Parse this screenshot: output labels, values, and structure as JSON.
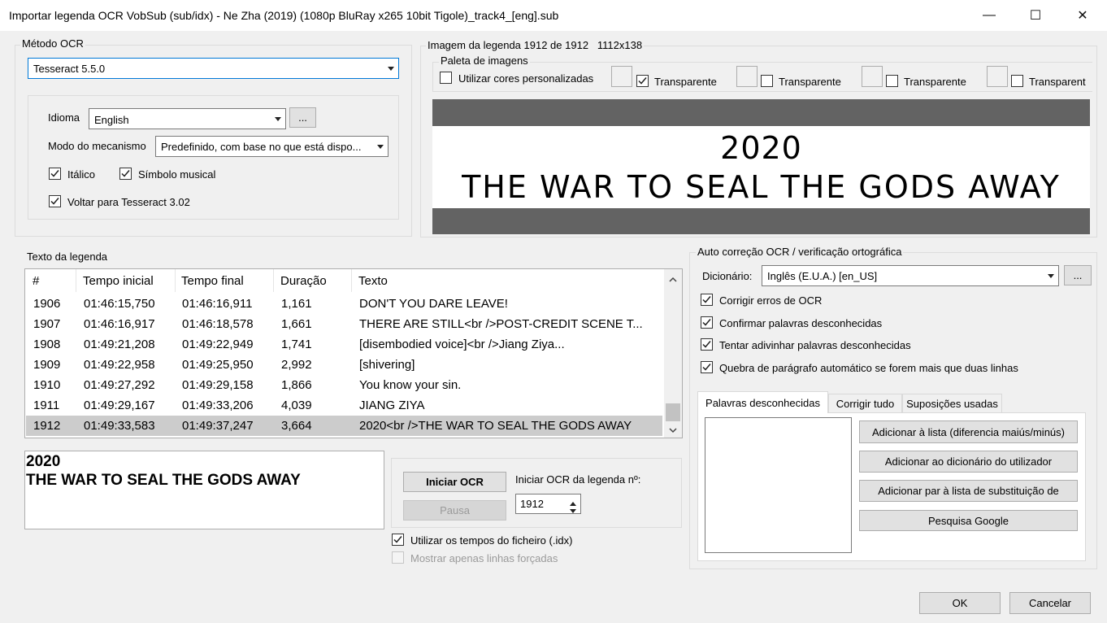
{
  "window": {
    "title": "Importar legenda OCR VobSub (sub/idx) - Ne Zha (2019) (1080p BluRay x265 10bit Tigole)_track4_[eng].sub",
    "minimize": "—",
    "maximize": "☐",
    "close": "✕"
  },
  "ocr_method": {
    "group_label": "Método OCR",
    "engine": "Tesseract 5.5.0",
    "language_label": "Idioma",
    "language": "English",
    "language_more": "...",
    "engine_mode_label": "Modo do mecanismo",
    "engine_mode": "Predefinido, com base no que está dispo...",
    "italic_label": "Itálico",
    "italic_checked": true,
    "music_label": "Símbolo musical",
    "music_checked": true,
    "fallback_label": "Voltar para Tesseract 3.02",
    "fallback_checked": true
  },
  "image": {
    "group_label": "Imagem da legenda 1912 de 1912   1112x138",
    "palette_label": "Paleta de imagens",
    "custom_colors_label": "Utilizar cores personalizadas",
    "custom_colors_checked": false,
    "transparent_label": "Transparente",
    "transparent_label_cut": "Transparent",
    "transparent_checked": [
      true,
      false,
      false,
      false
    ],
    "preview_line1": "2020",
    "preview_line2": "THE WAR TO SEAL THE GODS AWAY"
  },
  "subtitles": {
    "group_label": "Texto da legenda",
    "columns": [
      "#",
      "Tempo inicial",
      "Tempo final",
      "Duração",
      "Texto"
    ],
    "rows": [
      [
        "1906",
        "01:46:15,750",
        "01:46:16,911",
        "1,161",
        "DON'T YOU DARE LEAVE!"
      ],
      [
        "1907",
        "01:46:16,917",
        "01:46:18,578",
        "1,661",
        "THERE ARE STILL<br />POST-CREDIT SCENE T..."
      ],
      [
        "1908",
        "01:49:21,208",
        "01:49:22,949",
        "1,741",
        "[disembodied voice]<br />Jiang Ziya..."
      ],
      [
        "1909",
        "01:49:22,958",
        "01:49:25,950",
        "2,992",
        "[shivering]"
      ],
      [
        "1910",
        "01:49:27,292",
        "01:49:29,158",
        "1,866",
        "You know your sin."
      ],
      [
        "1911",
        "01:49:29,167",
        "01:49:33,206",
        "4,039",
        "JIANG ZIYA"
      ],
      [
        "1912",
        "01:49:33,583",
        "01:49:37,247",
        "3,664",
        "2020<br />THE WAR TO SEAL THE GODS AWAY"
      ]
    ],
    "selected_index": 6,
    "edit_line1": "2020",
    "edit_line2": "THE WAR TO SEAL THE GODS AWAY"
  },
  "controls": {
    "start_ocr": "Iniciar OCR",
    "pause": "Pausa",
    "start_from_label": "Iniciar OCR da legenda nº:",
    "start_from_value": "1912",
    "use_idx_times_label": "Utilizar os tempos do ficheiro (.idx)",
    "use_idx_times_checked": true,
    "forced_only_label": "Mostrar apenas linhas forçadas",
    "forced_only_checked": false
  },
  "autocorrect": {
    "group_label": "Auto correção OCR / verificação ortográfica",
    "dictionary_label": "Dicionário:",
    "dictionary": "Inglês (E.U.A.) [en_US]",
    "dictionary_more": "...",
    "options": [
      {
        "label": "Corrigir erros de OCR",
        "checked": true
      },
      {
        "label": "Confirmar palavras desconhecidas",
        "checked": true
      },
      {
        "label": "Tentar adivinhar palavras desconhecidas",
        "checked": true
      },
      {
        "label": "Quebra de parágrafo automático se forem mais que duas linhas",
        "checked": true
      }
    ],
    "tabs": [
      "Palavras desconhecidas",
      "Corrigir tudo",
      "Suposições usadas"
    ],
    "active_tab": 0,
    "buttons": [
      "Adicionar à lista (diferencia maiús/minús)",
      "Adicionar ao dicionário do utilizador",
      "Adicionar par à lista de substituição de",
      "Pesquisa Google"
    ]
  },
  "footer": {
    "ok": "OK",
    "cancel": "Cancelar"
  }
}
